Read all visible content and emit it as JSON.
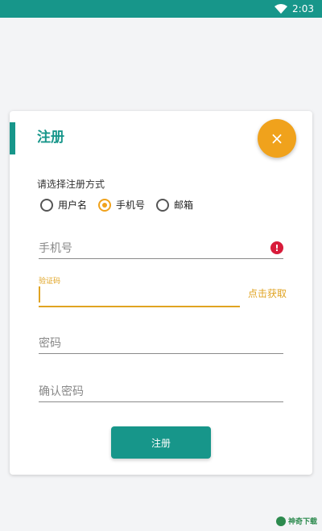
{
  "status_bar": {
    "time": "2:03",
    "wifi_icon": "wifi-icon"
  },
  "card": {
    "title": "注册",
    "close_glyph": "×",
    "prompt": "请选择注册方式",
    "radio_options": [
      {
        "label": "用户名",
        "checked": false
      },
      {
        "label": "手机号",
        "checked": true
      },
      {
        "label": "邮箱",
        "checked": false
      }
    ],
    "phone_placeholder": "手机号",
    "error_glyph": "!",
    "code_label": "验证码",
    "code_value": "",
    "get_code_label": "点击获取",
    "password_placeholder": "密码",
    "confirm_placeholder": "确认密码",
    "submit_label": "注册"
  },
  "watermark": {
    "text": "神奇下载"
  },
  "colors": {
    "primary": "#17968a",
    "accent": "#f0a21c",
    "error": "#d81b3a"
  }
}
